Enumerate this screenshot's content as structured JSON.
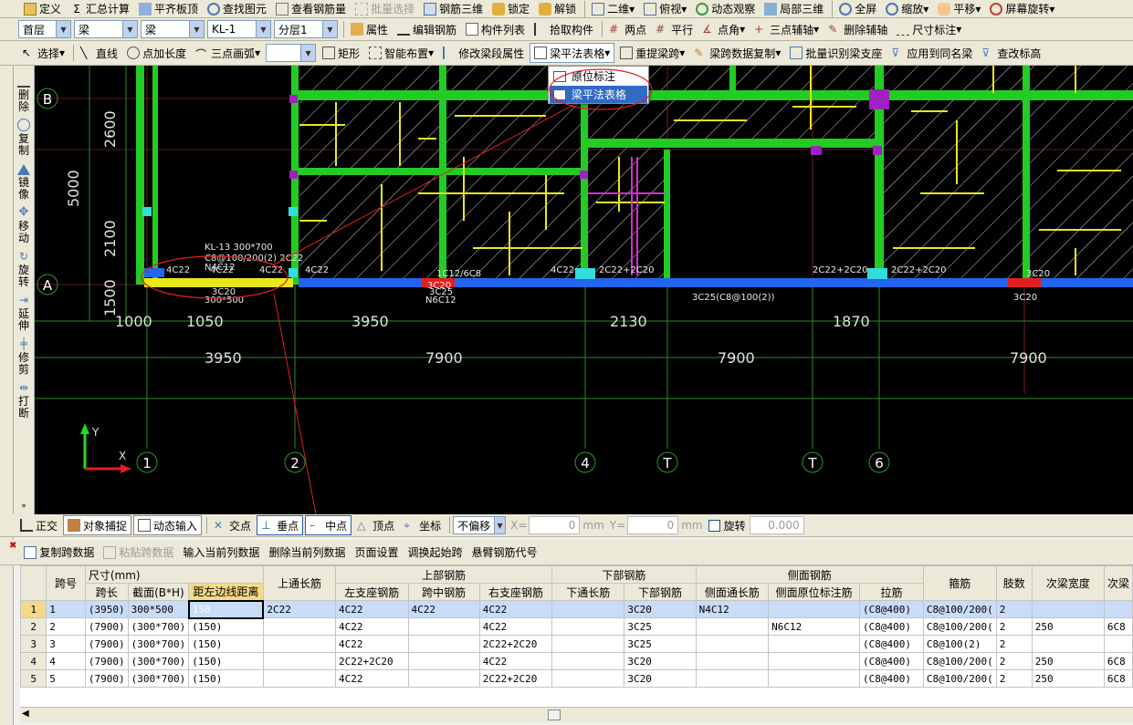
{
  "toolbar1": [
    "定义",
    "汇总计算",
    "平齐板顶",
    "查找图元",
    "查看钢筋量",
    "批量选择",
    "钢筋三维",
    "锁定",
    "解锁",
    "二维",
    "俯视",
    "动态观察",
    "局部三维",
    "全屏",
    "缩放",
    "平移",
    "屏幕旋转"
  ],
  "toolbar2": {
    "floor": "首层",
    "type": "梁",
    "subtype": "梁",
    "name": "KL-1",
    "layer": "分层1",
    "buttons": [
      "属性",
      "编辑钢筋",
      "构件列表",
      "拾取构件",
      "两点",
      "平行",
      "点角",
      "三点辅轴",
      "删除辅轴",
      "尺寸标注"
    ]
  },
  "toolbar3": [
    "选择",
    "直线",
    "点加长度",
    "三点画弧",
    "矩形",
    "智能布置",
    "修改梁段属性",
    "梁平法表格",
    "重提梁跨",
    "梁跨数据复制",
    "批量识别梁支座",
    "应用到同名梁",
    "查改标高"
  ],
  "dropdown_menu": [
    "原位标注",
    "梁平法表格"
  ],
  "side_tools": [
    "删除",
    "复制",
    "镜像",
    "移动",
    "旋转",
    "延伸",
    "修剪",
    "打断"
  ],
  "cad": {
    "axis_rows": [
      "B",
      "A"
    ],
    "axis_cols": [
      "1",
      "2",
      "4",
      "T",
      "T",
      "6"
    ],
    "dims_vertical": [
      "2600",
      "5000",
      "2100",
      "1500"
    ],
    "dims_row1": [
      "1000",
      "1050",
      "3950",
      "2130",
      "1870"
    ],
    "dims_row2": [
      "3950",
      "7900",
      "7900",
      "7900"
    ],
    "beam_texts": [
      "KL-13 300*700",
      "C8@100/200(2) 2C22",
      "N4C12",
      "4C22",
      "4C22",
      "4C22",
      "3C20",
      "300*500",
      "3C25",
      "N6C12",
      "2C22+2C20",
      "2C22+2C20",
      "3C25(C8@100(2))",
      "3C20",
      "3C20",
      "4C22",
      "4C22",
      "2C22+2C20",
      "3C20",
      "1C12/6C8",
      "1C12/6C8",
      "1C12/6C8"
    ],
    "ucs_y": "Y",
    "ucs_x": "X"
  },
  "status": [
    "正交",
    "对象捕捉",
    "动态输入",
    "交点",
    "垂点",
    "中点",
    "顶点",
    "坐标",
    "不偏移",
    "X=",
    "0",
    "mm",
    "Y=",
    "0",
    "mm",
    "旋转",
    "0.000"
  ],
  "table_toolbar": [
    "复制跨数据",
    "粘贴跨数据",
    "输入当前列数据",
    "删除当前列数据",
    "页面设置",
    "调换起始跨",
    "悬臂钢筋代号"
  ],
  "table": {
    "group_headers": [
      "尺寸(mm)",
      "上部钢筋",
      "下部钢筋",
      "侧面钢筋"
    ],
    "headers": [
      "跨号",
      "跨长",
      "截面(B*H)",
      "距左边线距离",
      "上通长筋",
      "左支座钢筋",
      "跨中钢筋",
      "右支座钢筋",
      "下通长筋",
      "下部钢筋",
      "侧面通长筋",
      "侧面原位标注筋",
      "拉筋",
      "箍筋",
      "肢数",
      "次梁宽度",
      "次梁"
    ],
    "rows": [
      [
        "1",
        "1",
        "(3950)",
        "300*500",
        "150",
        "2C22",
        "4C22",
        "4C22",
        "4C22",
        "",
        "3C20",
        "N4C12",
        "",
        "(C8@400)",
        "C8@100/200(",
        "2",
        "",
        ""
      ],
      [
        "2",
        "2",
        "(7900)",
        "(300*700)",
        "(150)",
        "",
        "4C22",
        "",
        "4C22",
        "",
        "3C25",
        "",
        "N6C12",
        "(C8@400)",
        "C8@100/200(",
        "2",
        "250",
        "6C8"
      ],
      [
        "3",
        "3",
        "(7900)",
        "(300*700)",
        "(150)",
        "",
        "4C22",
        "",
        "2C22+2C20",
        "",
        "3C25",
        "",
        "",
        "(C8@400)",
        "C8@100(2)",
        "2",
        "",
        ""
      ],
      [
        "4",
        "4",
        "(7900)",
        "(300*700)",
        "(150)",
        "",
        "2C22+2C20",
        "",
        "4C22",
        "",
        "3C20",
        "",
        "",
        "(C8@400)",
        "C8@100/200(",
        "2",
        "250",
        "6C8"
      ],
      [
        "5",
        "5",
        "(7900)",
        "(300*700)",
        "(150)",
        "",
        "4C22",
        "",
        "2C22+2C20",
        "",
        "3C20",
        "",
        "",
        "(C8@400)",
        "C8@100/200(",
        "2",
        "250",
        "6C8"
      ]
    ]
  }
}
